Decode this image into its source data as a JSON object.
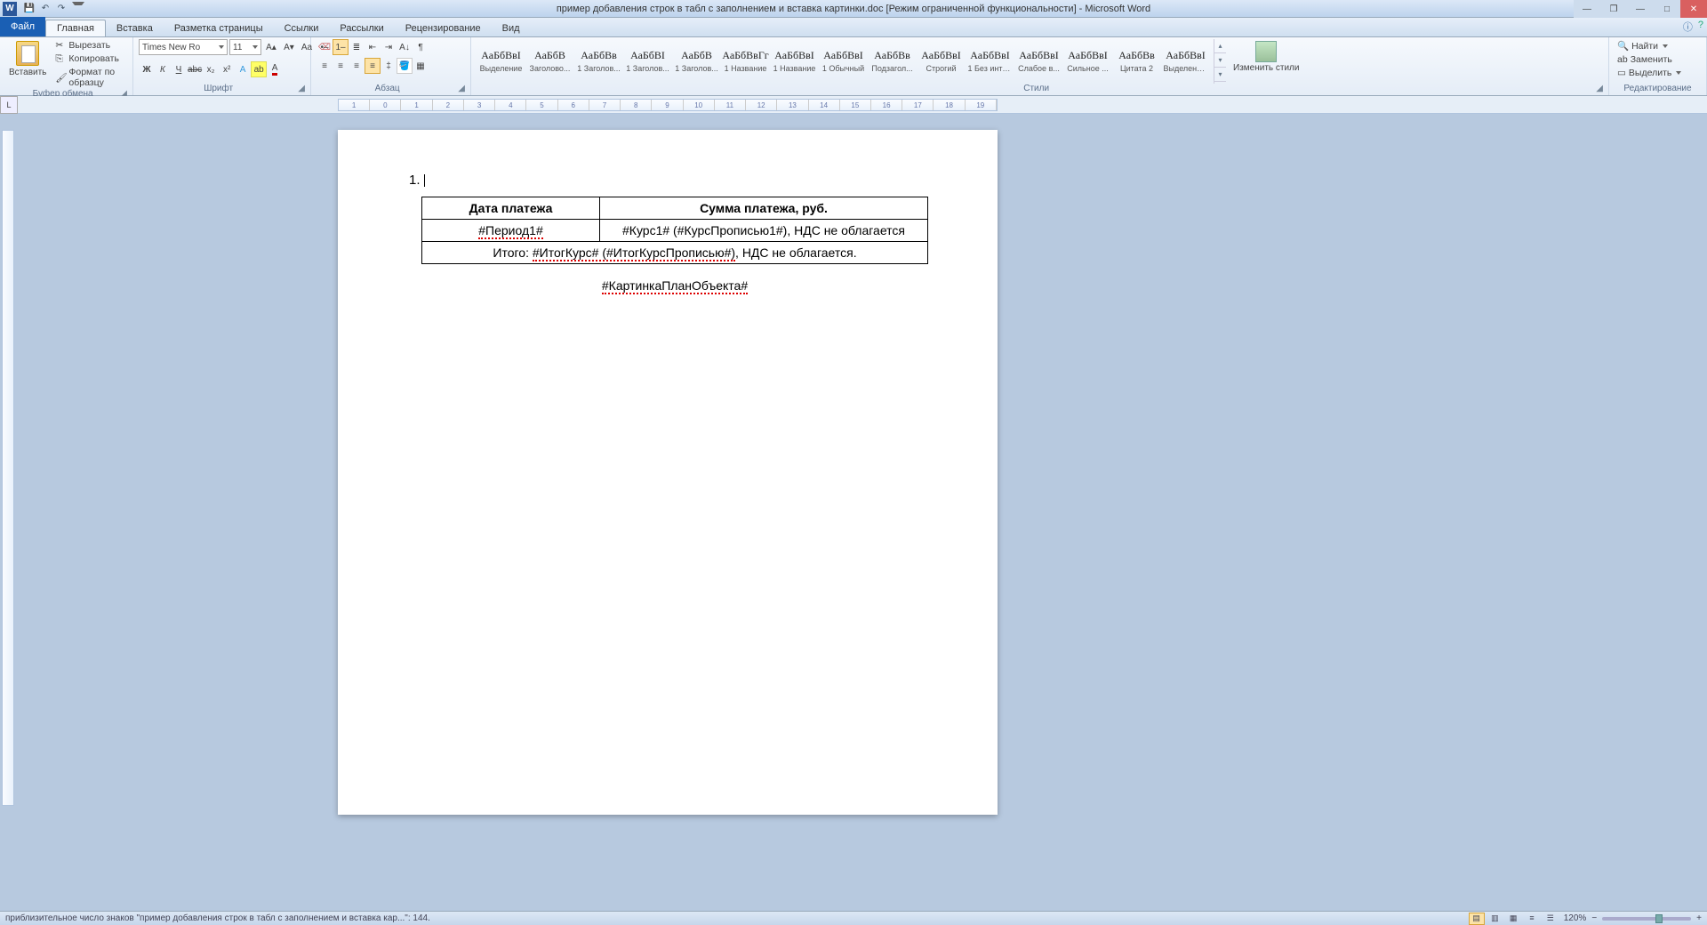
{
  "title": "пример добавления строк в табл с заполнением и вставка картинки.doc [Режим ограниченной функциональности] - Microsoft Word",
  "tabs": {
    "file": "Файл",
    "home": "Главная",
    "insert": "Вставка",
    "layout": "Разметка страницы",
    "refs": "Ссылки",
    "mail": "Рассылки",
    "review": "Рецензирование",
    "view": "Вид"
  },
  "clipboard": {
    "paste": "Вставить",
    "cut": "Вырезать",
    "copy": "Копировать",
    "fmt": "Формат по образцу",
    "group": "Буфер обмена"
  },
  "font": {
    "name": "Times New Ro",
    "size": "11",
    "group": "Шрифт"
  },
  "para": {
    "group": "Абзац"
  },
  "styles": {
    "group": "Стили",
    "change": "Изменить стили",
    "items": [
      {
        "p": "АаБбВвI",
        "n": "Выделение"
      },
      {
        "p": "АаБбВ",
        "n": "Заголово..."
      },
      {
        "p": "АаБбВв",
        "n": "1 Заголов..."
      },
      {
        "p": "АаБбВI",
        "n": "1 Заголов..."
      },
      {
        "p": "АаБбВ",
        "n": "1 Заголов..."
      },
      {
        "p": "АаБбВвГг",
        "n": "1 Название"
      },
      {
        "p": "АаБбВвI",
        "n": "1 Название"
      },
      {
        "p": "АаБбВвI",
        "n": "1 Обычный"
      },
      {
        "p": "АаБбВв",
        "n": "Подзагол..."
      },
      {
        "p": "АаБбВвI",
        "n": "Строгий"
      },
      {
        "p": "АаБбВвI",
        "n": "1 Без инте..."
      },
      {
        "p": "АаБбВвI",
        "n": "Слабое в..."
      },
      {
        "p": "АаБбВвI",
        "n": "Сильное ..."
      },
      {
        "p": "АаБбВв",
        "n": "Цитата 2"
      },
      {
        "p": "АаБбВвI",
        "n": "Выделенн..."
      }
    ]
  },
  "editing": {
    "find": "Найти",
    "replace": "Заменить",
    "select": "Выделить",
    "group": "Редактирование"
  },
  "doc": {
    "h1": "Дата платежа",
    "h2": "Сумма платежа, руб.",
    "c1": "#Период1#",
    "c2": "#Курс1# (#КурсПрописью1#), НДС не облагается",
    "sum_pre": "Итого: ",
    "sum_mid": "#ИтогКурс# (#ИтогКурсПрописью#)",
    "sum_post": ", НДС не облагается.",
    "caption": "#КартинкаПланОбъекта#"
  },
  "status": {
    "left": "приблизительное число знаков \"пример добавления строк в табл с заполнением и вставка кар...\": 144.",
    "zoom": "120%"
  }
}
